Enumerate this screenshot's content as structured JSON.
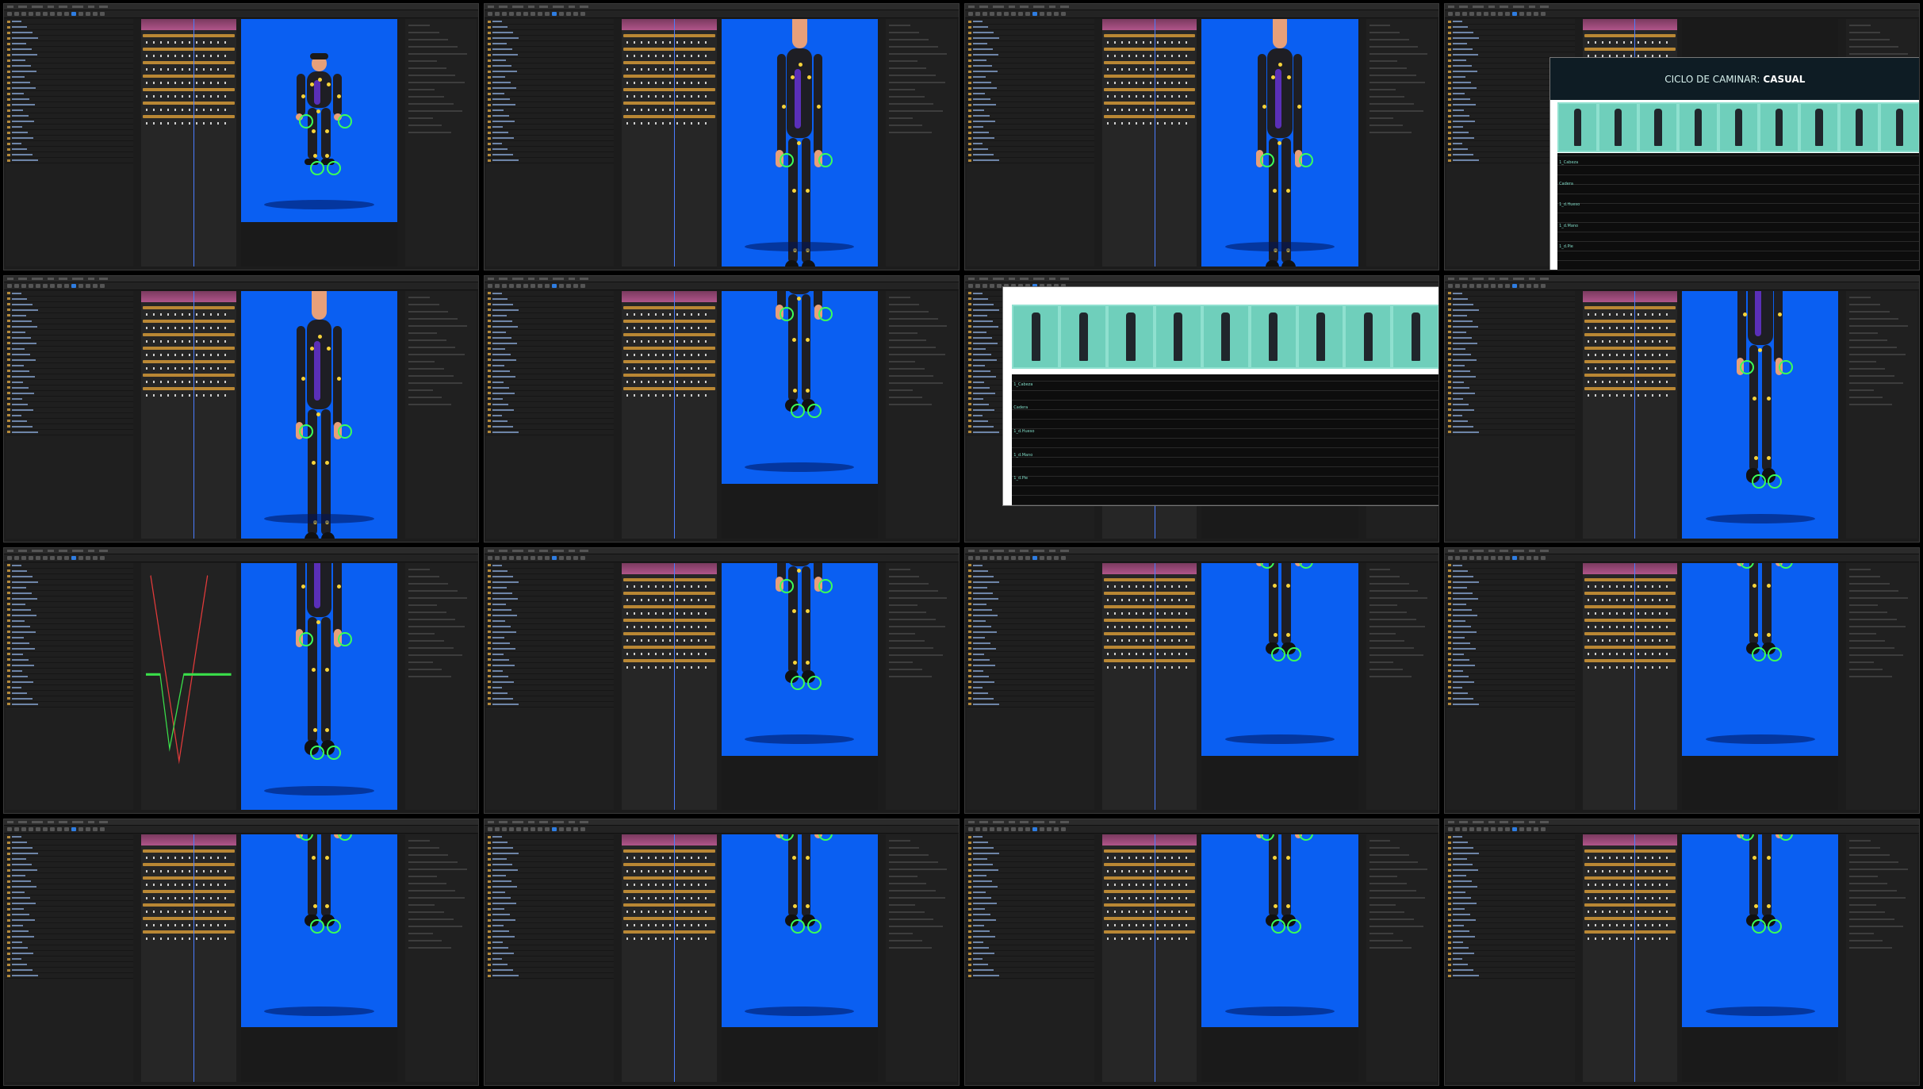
{
  "doc": {
    "title_prefix": "CICLO DE CAMINAR:",
    "title_bold": "CASUAL"
  },
  "doc_table_labels": [
    "1_Cabeza",
    "Cadera",
    "1_d.Hueso",
    "1_d.Mano",
    "1_d.Pie"
  ],
  "tiles": [
    {
      "id": "t1",
      "kind": "ae",
      "pose": "full"
    },
    {
      "id": "t2",
      "kind": "ae",
      "pose": "torso"
    },
    {
      "id": "t3",
      "kind": "ae",
      "pose": "torso-left"
    },
    {
      "id": "t4",
      "kind": "doc",
      "pose": ""
    },
    {
      "id": "t5",
      "kind": "ae",
      "pose": "torso"
    },
    {
      "id": "t6",
      "kind": "ae",
      "pose": "legs"
    },
    {
      "id": "t7",
      "kind": "doc2",
      "pose": ""
    },
    {
      "id": "t8",
      "kind": "ae",
      "pose": "mid"
    },
    {
      "id": "t9",
      "kind": "graph",
      "pose": "mid"
    },
    {
      "id": "t10",
      "kind": "ae",
      "pose": "legs"
    },
    {
      "id": "t11",
      "kind": "ae",
      "pose": "low"
    },
    {
      "id": "t12",
      "kind": "ae",
      "pose": "low"
    },
    {
      "id": "t13",
      "kind": "ae",
      "pose": "low"
    },
    {
      "id": "t14",
      "kind": "ae",
      "pose": "low"
    },
    {
      "id": "t15",
      "kind": "ae",
      "pose": "low"
    },
    {
      "id": "t16",
      "kind": "ae",
      "pose": "low"
    }
  ]
}
